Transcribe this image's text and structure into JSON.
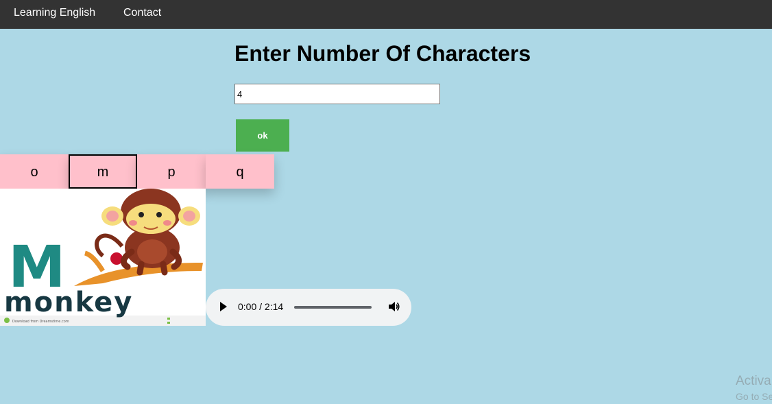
{
  "nav": {
    "items": [
      "Learning English",
      "Contact"
    ]
  },
  "form": {
    "heading": "Enter Number Of Characters",
    "input_value": "4",
    "button_label": "ok"
  },
  "letters": {
    "items": [
      "o",
      "m",
      "p",
      "q"
    ],
    "selected_index": 1
  },
  "image": {
    "word": "monkey",
    "big_letter": "M",
    "footer_text": "Download from Dreamstime.com"
  },
  "audio": {
    "time": "0:00 / 2:14",
    "progress": 0
  },
  "watermark": {
    "line1": "Activa",
    "line2": "Go to Se"
  },
  "colors": {
    "nav_bg": "#333333",
    "page_bg": "#add8e6",
    "button_bg": "#4caf50",
    "letter_bg": "#ffc0cb"
  }
}
